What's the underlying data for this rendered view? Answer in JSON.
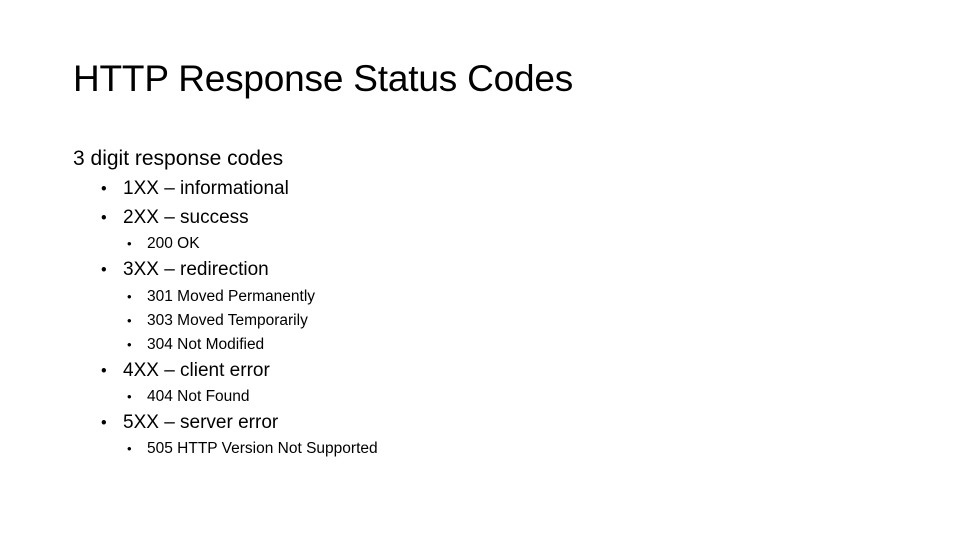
{
  "slide": {
    "title": "HTTP Response Status Codes",
    "intro": "3 digit response codes",
    "bullet_glyph": "•",
    "items": [
      {
        "label": "1XX – informational"
      },
      {
        "label": "2XX – success",
        "sub": [
          "200 OK"
        ]
      },
      {
        "label": "3XX – redirection",
        "sub": [
          "301 Moved Permanently",
          "303 Moved Temporarily",
          "304 Not Modified"
        ]
      },
      {
        "label": "4XX – client error",
        "sub": [
          "404 Not Found"
        ]
      },
      {
        "label": "5XX – server error",
        "sub": [
          "505 HTTP Version Not Supported"
        ]
      }
    ]
  }
}
